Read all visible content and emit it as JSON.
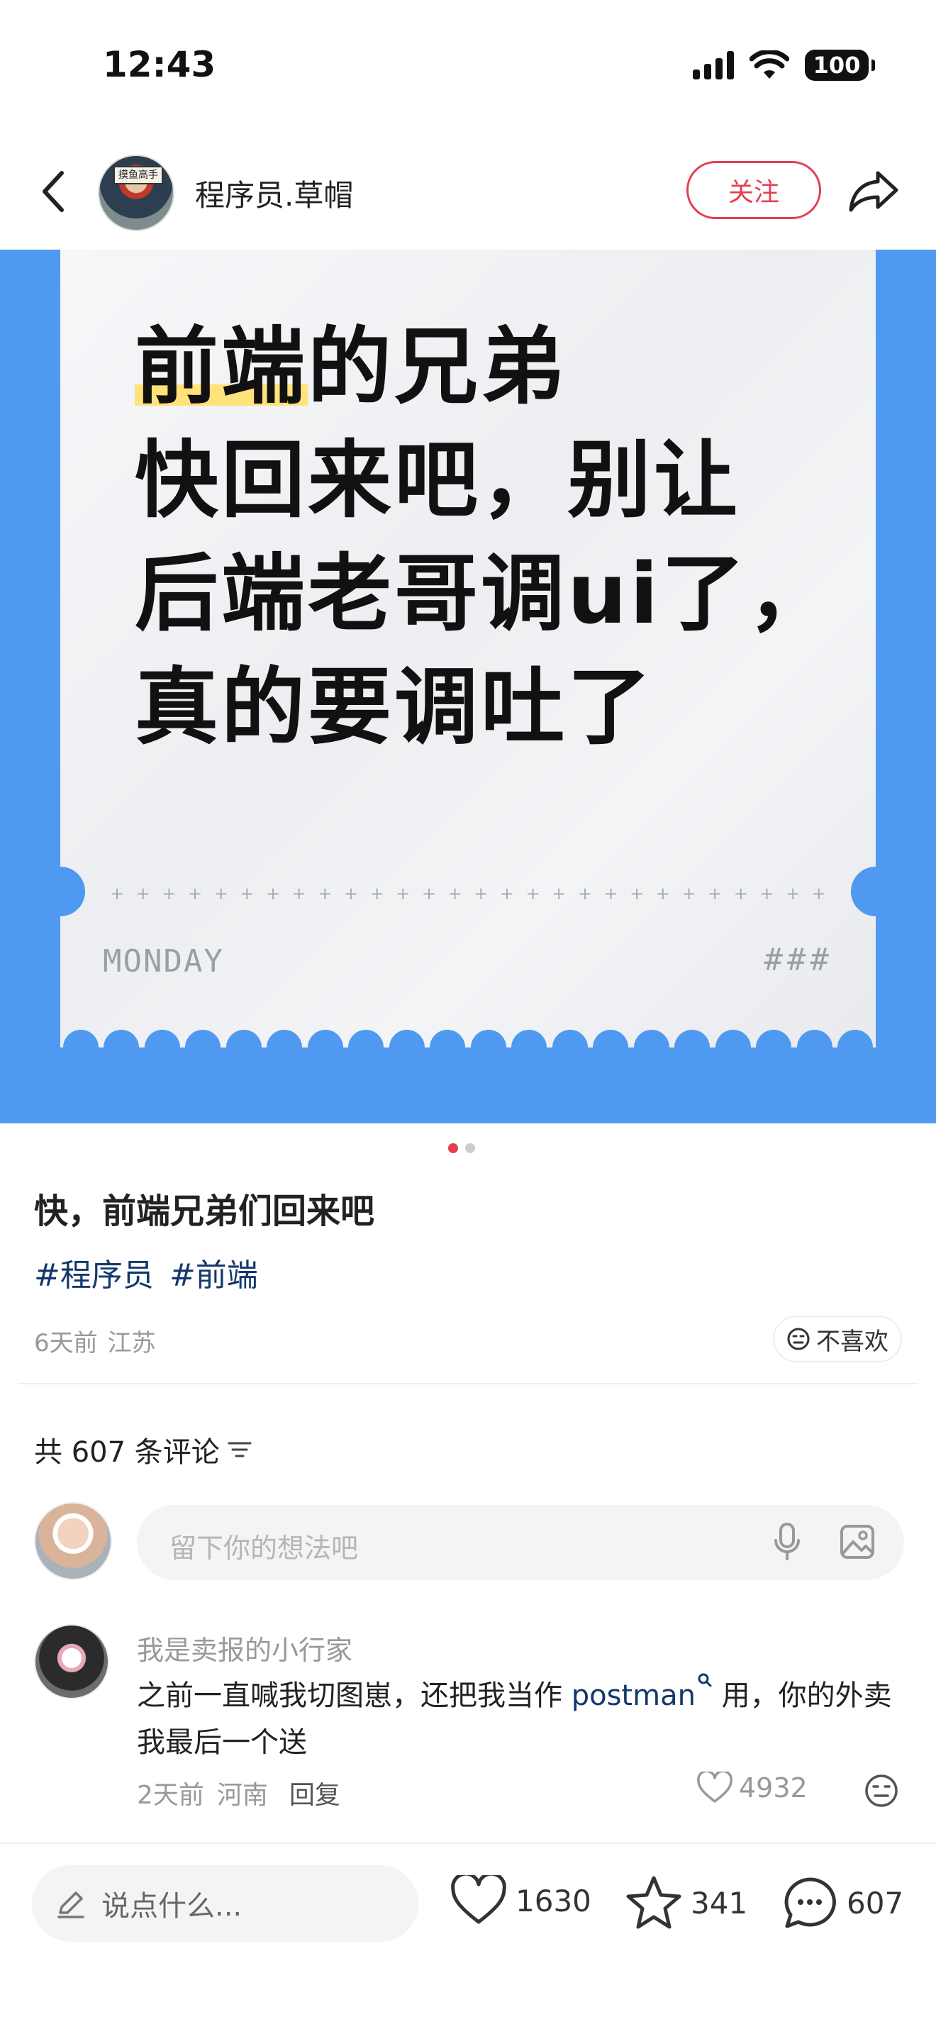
{
  "status_bar": {
    "time": "12:43",
    "battery": "100",
    "icons": [
      "signal-icon",
      "wifi-icon",
      "battery-icon"
    ]
  },
  "header": {
    "author_name": "程序员.草帽",
    "avatar_sign_text": "摸鱼高手",
    "follow_label": "关注",
    "icons": [
      "back-arrow-icon",
      "share-icon"
    ]
  },
  "hero": {
    "lines": [
      "快回来吧，别让",
      "后端老哥调ui了，",
      "真的要调吐了"
    ],
    "line1_highlight": "前端",
    "line1_rest": "的兄弟",
    "footer_left": "MONDAY",
    "footer_right": "###",
    "background_color": "#4f9af0",
    "highlight_color": "#ffe27a"
  },
  "pager": {
    "total": 2,
    "active_index": 0,
    "active_color": "#e43f4f",
    "inactive_color": "#cccccc"
  },
  "post": {
    "title": "快，前端兄弟们回来吧",
    "tags": [
      "#程序员",
      "#前端"
    ],
    "time": "6天前",
    "location": "江苏",
    "dislike_label": "不喜欢"
  },
  "comments": {
    "count_label": "共 607 条评论",
    "input_placeholder": "留下你的想法吧",
    "items": [
      {
        "user": "我是卖报的小行家",
        "text_before": "之前一直喊我切图崽，还把我当作 ",
        "link": "postman",
        "text_after": " 用，你的外卖我最后一个送",
        "time": "2天前",
        "location": "河南",
        "reply_label": "回复",
        "likes": "4932"
      }
    ]
  },
  "bottom_bar": {
    "input_placeholder": "说点什么...",
    "likes": "1630",
    "stars": "341",
    "comments": "607"
  },
  "colors": {
    "accent_red": "#e43f4f",
    "tag_blue": "#13386c"
  }
}
